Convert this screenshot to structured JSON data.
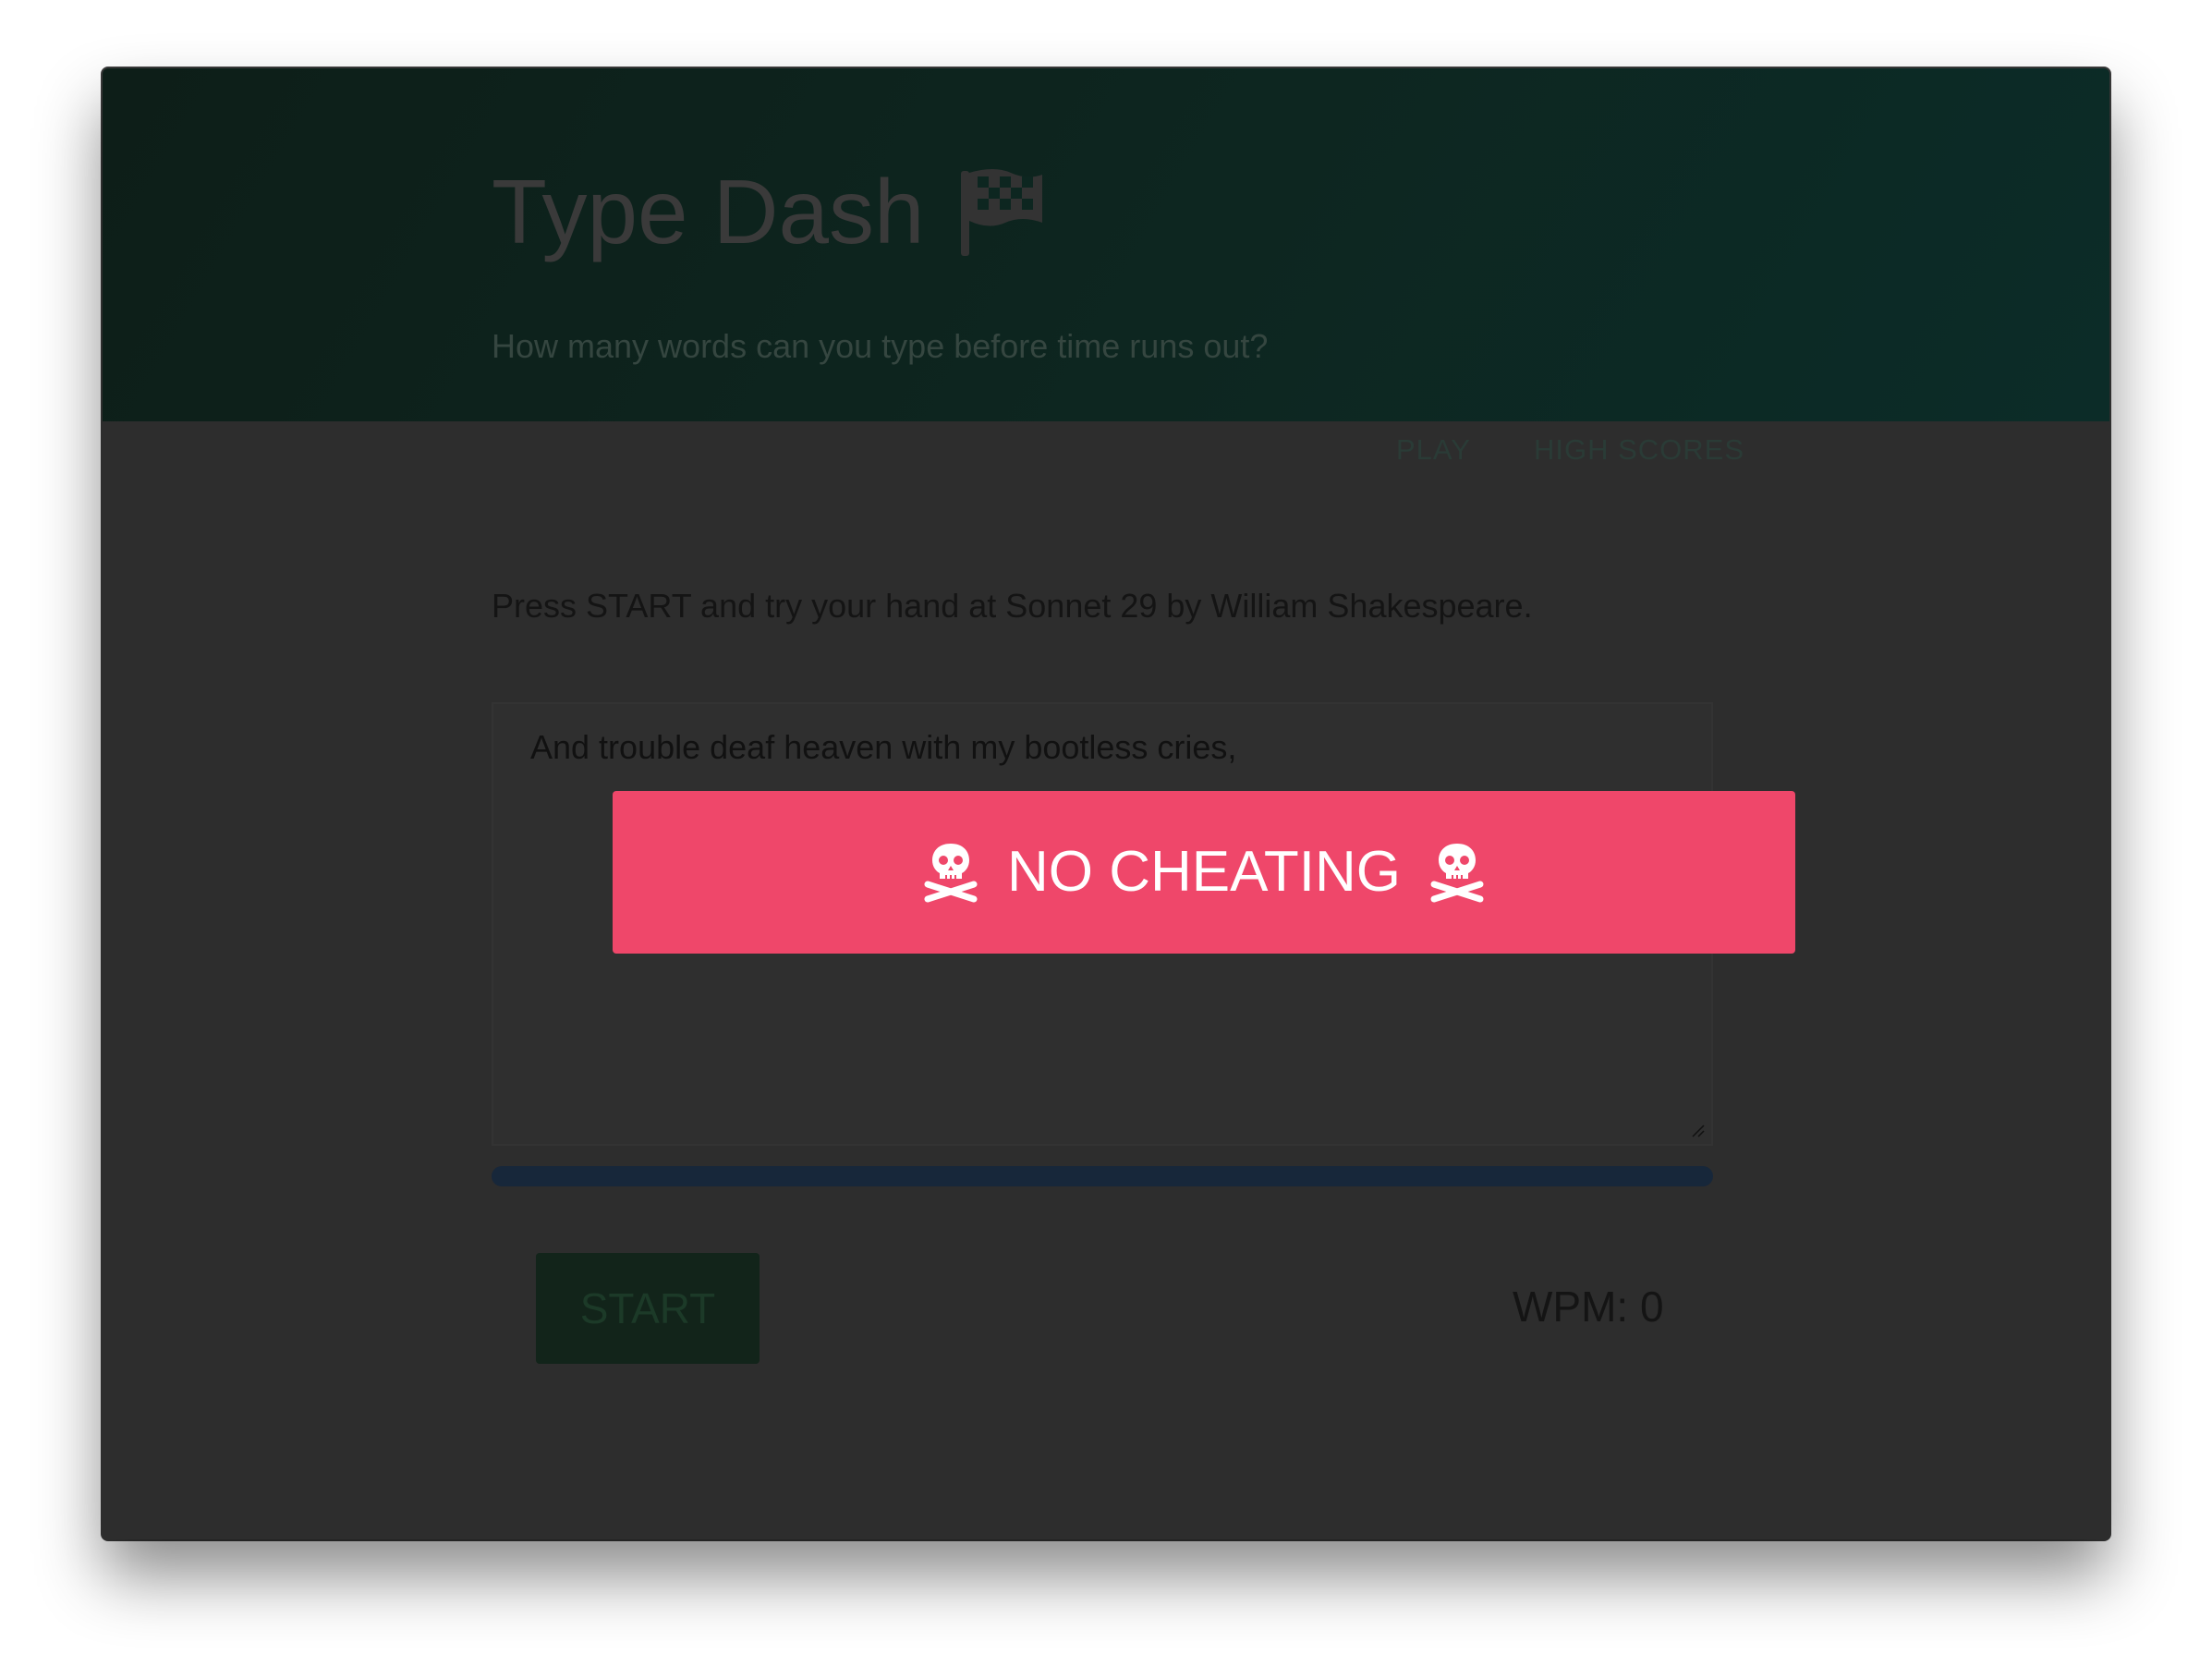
{
  "app": {
    "title": "Type Dash",
    "title_icon": "checkered-flag-icon",
    "subtitle": "How many words can you type before time runs out?"
  },
  "nav": {
    "items": [
      {
        "label": "PLAY"
      },
      {
        "label": "HIGH SCORES"
      }
    ]
  },
  "game": {
    "instructions": "Press START and try your hand at Sonnet 29 by William Shakespeare.",
    "sonnet_lines": [
      "And trouble deaf heaven with my bootless cries,"
    ],
    "progress_fraction": 0,
    "start_label": "START",
    "wpm_label": "WPM: 0"
  },
  "alert": {
    "text": "NO CHEATING",
    "icon": "skull-and-crossbones-icon",
    "color": "#ef476a"
  },
  "colors": {
    "header_bg": "#0d2620",
    "overlay_bg": "#2d2d2d",
    "alert_bg": "#ef476a"
  }
}
